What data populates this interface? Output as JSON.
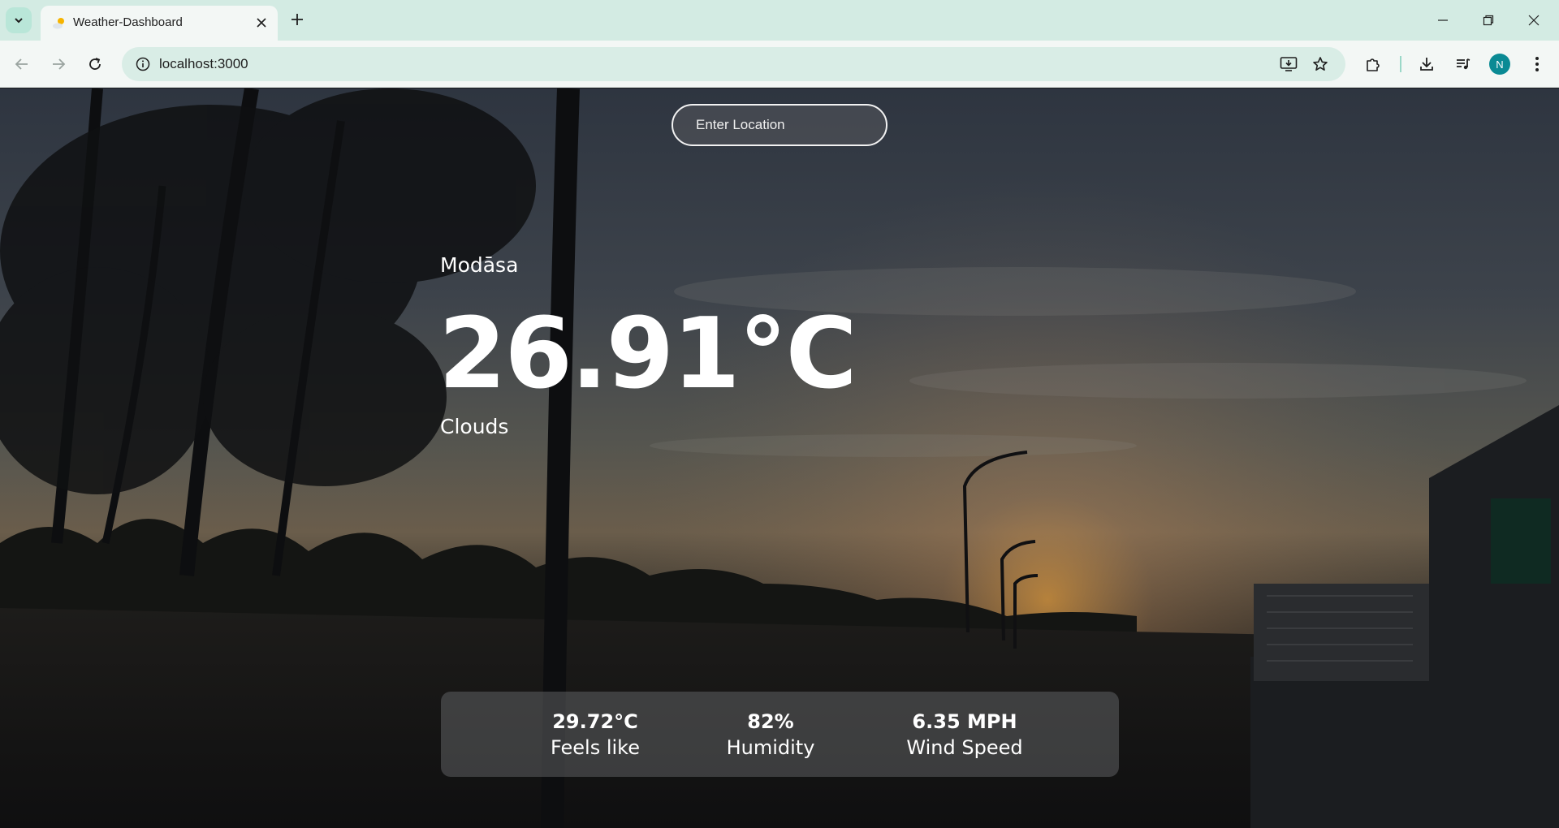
{
  "browser": {
    "tab_title": "Weather-Dashboard",
    "url": "localhost:3000",
    "profile_initial": "N"
  },
  "search": {
    "placeholder": "Enter Location",
    "value": ""
  },
  "weather": {
    "city": "Modāsa",
    "temperature": "26.91°C",
    "description": "Clouds"
  },
  "stats": [
    {
      "value": "29.72°C",
      "label": "Feels like"
    },
    {
      "value": "82%",
      "label": "Humidity"
    },
    {
      "value": "6.35 MPH",
      "label": "Wind Speed"
    }
  ],
  "colors": {
    "tabbar_bg": "#d3ebe3",
    "toolbar_bg": "#f3f7f5",
    "omnibox_bg": "#d9ede6",
    "avatar_bg": "#0a8a94",
    "text": "#ffffff"
  }
}
